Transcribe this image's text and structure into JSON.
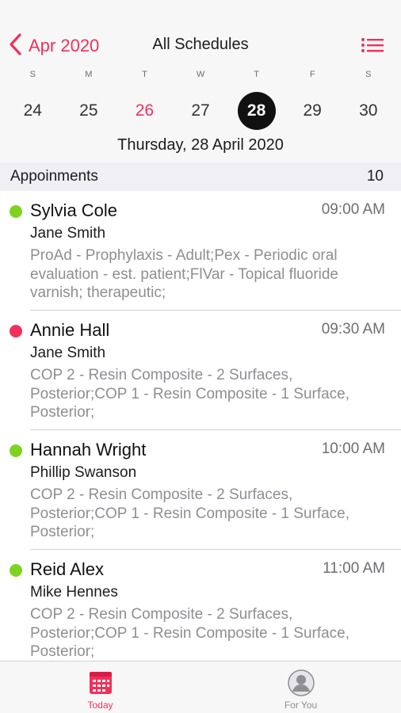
{
  "nav": {
    "back_label": "Apr 2020",
    "title": "All Schedules",
    "list_icon": "list-icon"
  },
  "calendar": {
    "weekdays": [
      "S",
      "M",
      "T",
      "W",
      "T",
      "F",
      "S"
    ],
    "dates": [
      "24",
      "25",
      "26",
      "27",
      "28",
      "29",
      "30"
    ],
    "selected_date_label": "Thursday, 28 April 2020"
  },
  "colors": {
    "accent": "#f2305a",
    "status_green": "#7ed321",
    "status_red": "#f2305a"
  },
  "appointments": {
    "header_label": "Appoinments",
    "count": "10",
    "items": [
      {
        "patient": "Sylvia Cole",
        "time": "09:00 AM",
        "provider": "Jane Smith",
        "procedures": "ProAd - Prophylaxis - Adult;Pex - Periodic oral evaluation - est. patient;FlVar - Topical fluoride varnish; therapeutic;",
        "status_color": "#7ed321"
      },
      {
        "patient": "Annie Hall",
        "time": "09:30 AM",
        "provider": "Jane Smith",
        "procedures": "COP  2 - Resin Composite - 2 Surfaces, Posterior;COP  1 - Resin Composite - 1 Surface, Posterior;",
        "status_color": "#f2305a"
      },
      {
        "patient": "Hannah Wright",
        "time": "10:00 AM",
        "provider": "Phillip Swanson",
        "procedures": "COP  2 - Resin Composite - 2 Surfaces, Posterior;COP  1 - Resin Composite - 1 Surface, Posterior;",
        "status_color": "#7ed321"
      },
      {
        "patient": "Reid Alex",
        "time": "11:00 AM",
        "provider": "Mike Hennes",
        "procedures": "COP  2 - Resin Composite - 2 Surfaces, Posterior;COP  1 - Resin Composite - 1 Surface, Posterior;",
        "status_color": "#7ed321"
      }
    ]
  },
  "tabs": {
    "today_label": "Today",
    "today_icon": "calendar-icon",
    "foryou_label": "For You",
    "foryou_icon": "person-icon"
  }
}
